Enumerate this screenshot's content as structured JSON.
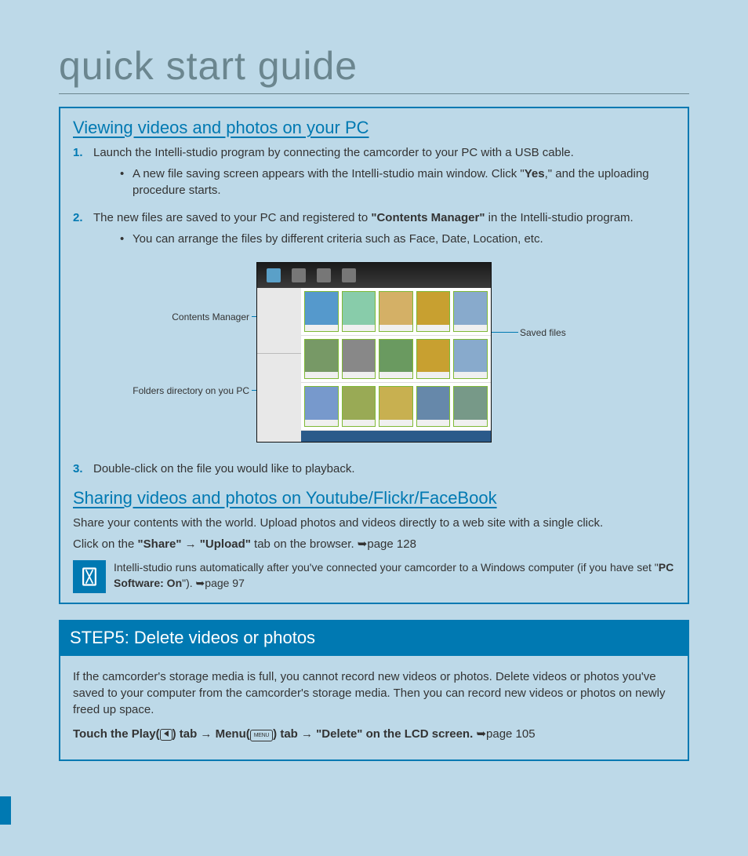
{
  "title": "quick start guide",
  "section1": {
    "heading": "Viewing videos and photos on your PC",
    "step1_num": "1.",
    "step1_text": "Launch the Intelli-studio program by connecting the camcorder to your PC with a USB cable.",
    "step1_b1a": "A new file saving screen appears with the Intelli-studio main window. Click \"",
    "step1_b1_bold": "Yes",
    "step1_b1c": ",\" and the uploading procedure starts.",
    "step2_num": "2.",
    "step2a": "The new files are saved to your PC and registered to ",
    "step2_bold": "\"Contents Manager\"",
    "step2c": " in the Intelli-studio program.",
    "step2_b1": "You can arrange the files by different criteria such as Face, Date, Location, etc.",
    "step3_num": "3.",
    "step3_text": "Double-click on the file you would like to playback.",
    "callout_cm": "Contents Manager",
    "callout_folders": "Folders directory on you PC",
    "callout_saved": "Saved files"
  },
  "section2": {
    "heading": "Sharing videos and photos on Youtube/Flickr/FaceBook",
    "p1": "Share your contents with the world. Upload photos and videos directly to a web site with a single click.",
    "p2a": "Click on the ",
    "p2_bold1": "\"Share\" → \"Upload\"",
    "p2c": " tab on the browser. ",
    "p2_ref": "➥page 128",
    "info_a": "Intelli-studio runs automatically after you've connected your camcorder to a Windows computer (if you have set \"",
    "info_bold": "PC Software: On",
    "info_c": "\"). ",
    "info_ref": "➥page 97"
  },
  "step5": {
    "bar": "STEP5: Delete videos or photos",
    "p1": "If the camcorder's storage media is full, you cannot record new videos or photos. Delete videos or photos you've saved to your computer from the camcorder's storage media. Then you can record new videos or photos on newly freed up space.",
    "touch_a": "Touch the Play(",
    "touch_b": ") tab → Menu(",
    "menu_label": "MENU",
    "touch_c": ") tab → \"Delete\" on the LCD screen. ",
    "touch_ref": "➥page 105"
  }
}
